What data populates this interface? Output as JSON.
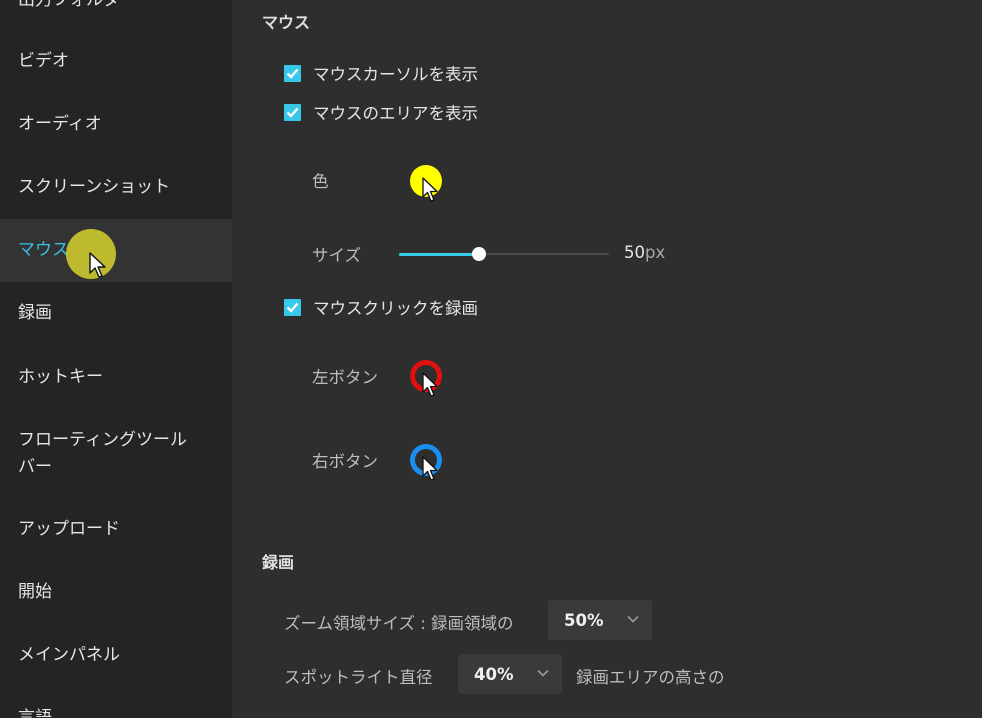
{
  "sidebar": {
    "items": [
      {
        "label": "出力フォルダ",
        "active": false
      },
      {
        "label": "ビデオ",
        "active": false
      },
      {
        "label": "オーディオ",
        "active": false
      },
      {
        "label": "スクリーンショット",
        "active": false
      },
      {
        "label": "マウス",
        "active": true
      },
      {
        "label": "録画",
        "active": false
      },
      {
        "label": "ホットキー",
        "active": false
      },
      {
        "label": "フローティングツールバー",
        "active": false
      },
      {
        "label": "アップロード",
        "active": false
      },
      {
        "label": "開始",
        "active": false
      },
      {
        "label": "メインパネル",
        "active": false
      },
      {
        "label": "言語",
        "active": false
      }
    ]
  },
  "mouse": {
    "title": "マウス",
    "show_cursor": {
      "label": "マウスカーソルを表示",
      "checked": true
    },
    "show_area": {
      "label": "マウスのエリアを表示",
      "checked": true
    },
    "color_label": "色",
    "color_value": "#ffff00",
    "size_label": "サイズ",
    "size_value": "50",
    "size_unit": "px",
    "size_fraction": 0.38,
    "record_clicks": {
      "label": "マウスクリックを録画",
      "checked": true
    },
    "left_button_label": "左ボタン",
    "left_button_color": "#e01010",
    "right_button_label": "右ボタン",
    "right_button_color": "#1a8ff0"
  },
  "recording": {
    "title": "録画",
    "zoom_prefix": "ズーム領域サイズ : 録画領域の",
    "zoom_value": "50%",
    "spotlight_prefix": "スポットライト直径",
    "spotlight_value": "40%",
    "spotlight_suffix": "録画エリアの高さの"
  },
  "colors": {
    "accent": "#38c8ea",
    "sidebar_bg": "#242424",
    "main_bg": "#2e2e2e"
  },
  "icons": [
    "check-icon",
    "cursor-arrow-icon",
    "chevron-down-icon"
  ]
}
